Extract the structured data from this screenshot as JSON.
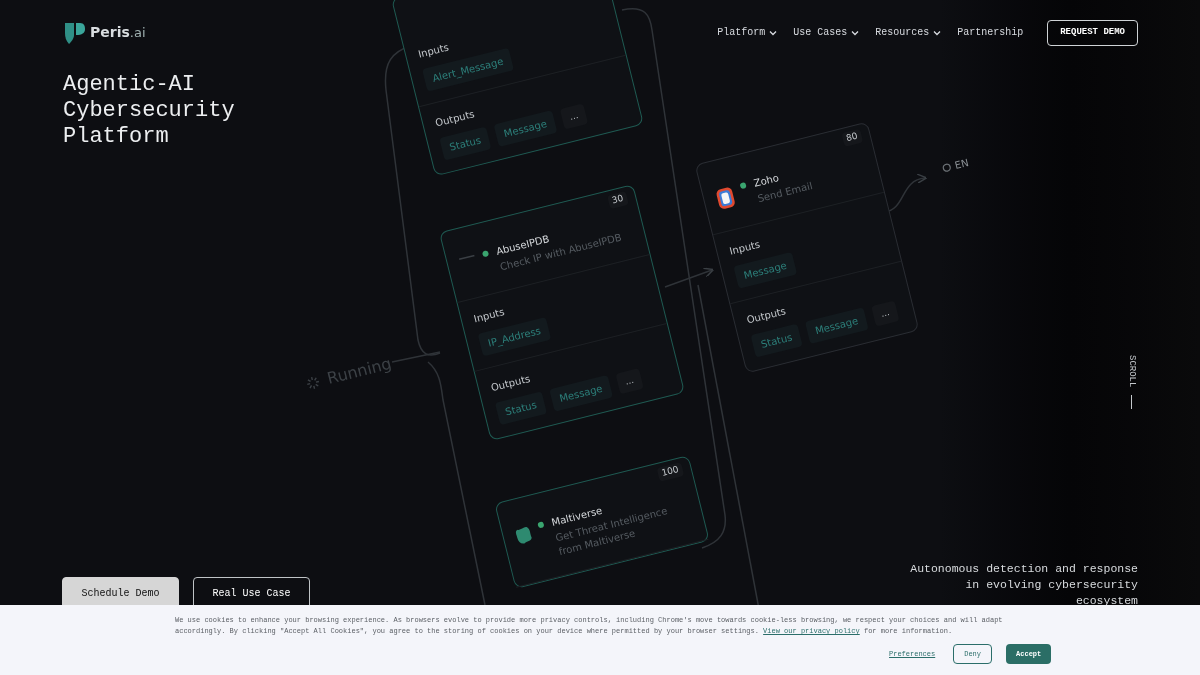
{
  "header": {
    "logo": {
      "name": "Peris",
      "suffix": ".ai"
    },
    "nav": [
      {
        "label": "Platform",
        "dropdown": true
      },
      {
        "label": "Use Cases",
        "dropdown": true
      },
      {
        "label": "Resources",
        "dropdown": true
      },
      {
        "label": "Partnership",
        "dropdown": false
      }
    ],
    "cta": "REQUEST DEMO"
  },
  "hero": {
    "title": "Agentic-AI Cybersecurity Platform",
    "buttons": [
      {
        "label": "Schedule Demo",
        "kind": "filled"
      },
      {
        "label": "Real Use Case",
        "kind": "outline"
      }
    ],
    "tagline": "Autonomous detection and response in evolving cybersecurity ecosystem",
    "scroll": "SCROLL"
  },
  "workflow": {
    "status": "Running",
    "end": "EN",
    "nodes": [
      {
        "highlighted": true,
        "inputs_label": "Inputs",
        "inputs": [
          "Alert_Message"
        ],
        "outputs_label": "Outputs",
        "outputs": [
          "Status",
          "Message"
        ],
        "more": "..."
      },
      {
        "highlighted": true,
        "kind": "generic",
        "title": "AbuseIPDB",
        "subtitle": "Check IP with AbuseIPDB",
        "score": "30",
        "inputs_label": "Inputs",
        "inputs": [
          "IP_Address"
        ],
        "outputs_label": "Outputs",
        "outputs": [
          "Status",
          "Message"
        ],
        "more": "..."
      },
      {
        "highlighted": false,
        "kind": "mail",
        "title": "Zoho",
        "subtitle": "Send Email",
        "score": "80",
        "inputs_label": "Inputs",
        "inputs": [
          "Message"
        ],
        "outputs_label": "Outputs",
        "outputs": [
          "Status",
          "Message"
        ],
        "more": "..."
      },
      {
        "highlighted": true,
        "kind": "blob",
        "title": "Maltiverse",
        "subtitle": "Get Threat Intelligence from Maltiverse",
        "score": "100"
      }
    ]
  },
  "cookie_banner": {
    "text_before": "We use cookies to enhance your browsing experience. As browsers evolve to provide more privacy controls, including Chrome's move towards cookie-less browsing, we respect your choices and will adapt accordingly. By clicking \"Accept All Cookies\", you agree to the storing of cookies on your device where permitted by your browser settings.",
    "link": "View our privacy policy",
    "text_after": "for more information.",
    "buttons": [
      {
        "label": "Preferences",
        "kind": "link"
      },
      {
        "label": "Deny",
        "kind": "outline"
      },
      {
        "label": "Accept",
        "kind": "filled"
      }
    ]
  }
}
